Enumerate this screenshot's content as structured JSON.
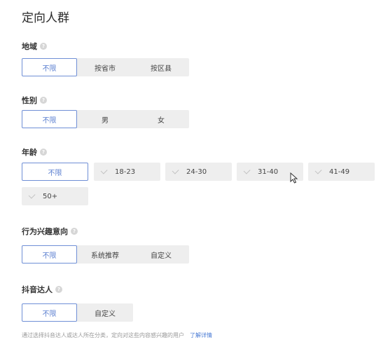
{
  "page_title": "定向人群",
  "region": {
    "label": "地域",
    "options": [
      "不限",
      "按省市",
      "按区县"
    ],
    "selected": "不限"
  },
  "gender": {
    "label": "性别",
    "options": [
      "不限",
      "男",
      "女"
    ],
    "selected": "不限"
  },
  "age": {
    "label": "年龄",
    "unlimited": "不限",
    "ranges": [
      "18-23",
      "24-30",
      "31-40",
      "41-49",
      "50+"
    ],
    "selected": "不限"
  },
  "interest": {
    "label": "行为兴趣意向",
    "options": [
      "不限",
      "系统推荐",
      "自定义"
    ],
    "selected": "不限"
  },
  "influencer": {
    "label": "抖音达人",
    "options": [
      "不限",
      "自定义"
    ],
    "selected": "不限",
    "hint": "通过选择抖音达人或达人所在分类，定向对这些内容感兴趣的用户",
    "learn_more": "了解详情"
  },
  "colors": {
    "accent": "#5b7fd0",
    "chip_bg": "#eeeeee"
  },
  "icons": {
    "help": "help-icon",
    "check": "check-icon",
    "cursor": "mouse-cursor-icon"
  }
}
